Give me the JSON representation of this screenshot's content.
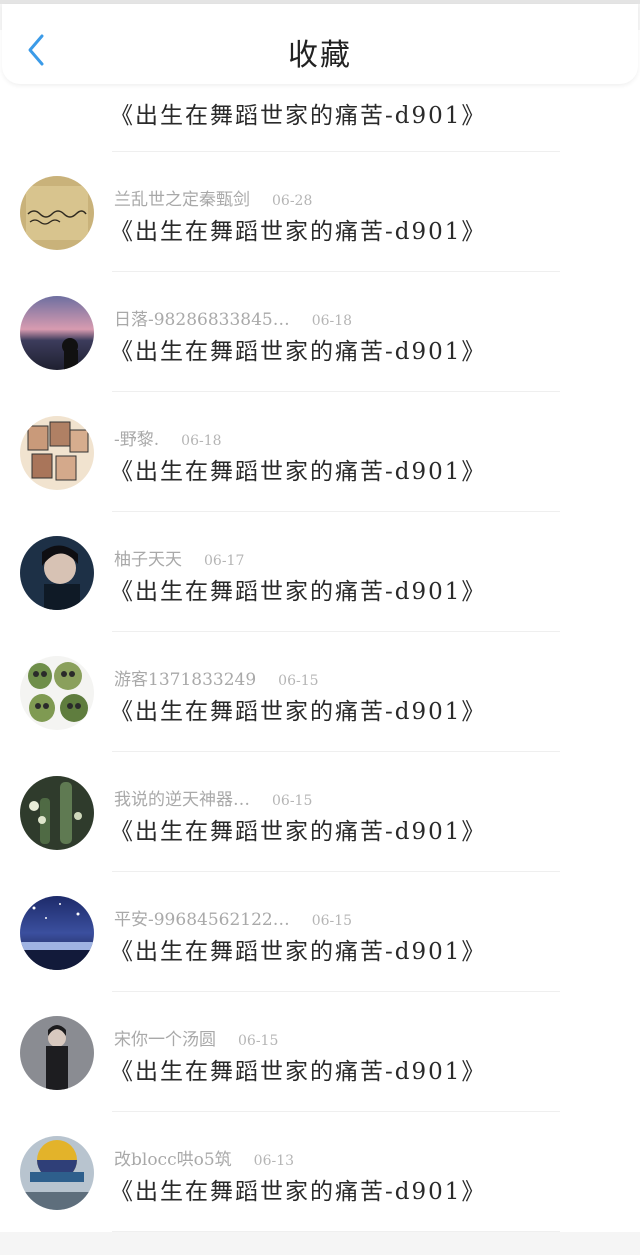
{
  "header": {
    "title": "收藏",
    "back_icon": "chevron-left-icon",
    "accent_color": "#3b9be8"
  },
  "items": [
    {
      "user": "",
      "date": "",
      "song": "《出生在舞蹈世家的痛苦-d901》",
      "avatar": "avatar-girl-photo"
    },
    {
      "user": "兰乱世之定秦甄剑",
      "date": "06-28",
      "song": "《出生在舞蹈世家的痛苦-d901》",
      "avatar": "avatar-handwriting-paper"
    },
    {
      "user": "日落-98286833845…",
      "date": "06-18",
      "song": "《出生在舞蹈世家的痛苦-d901》",
      "avatar": "avatar-sunset"
    },
    {
      "user": "-野黎.",
      "date": "06-18",
      "song": "《出生在舞蹈世家的痛苦-d901》",
      "avatar": "avatar-photo-collage"
    },
    {
      "user": "柚子天天",
      "date": "06-17",
      "song": "《出生在舞蹈世家的痛苦-d901》",
      "avatar": "avatar-portrait-dark"
    },
    {
      "user": "游客1371833249",
      "date": "06-15",
      "song": "《出生在舞蹈世家的痛苦-d901》",
      "avatar": "avatar-skulls"
    },
    {
      "user": "我说的逆天神器…",
      "date": "06-15",
      "song": "《出生在舞蹈世家的痛苦-d901》",
      "avatar": "avatar-plants"
    },
    {
      "user": "平安-99684562122…",
      "date": "06-15",
      "song": "《出生在舞蹈世家的痛苦-d901》",
      "avatar": "avatar-night-sky"
    },
    {
      "user": "宋你一个汤圆",
      "date": "06-15",
      "song": "《出生在舞蹈世家的痛苦-d901》",
      "avatar": "avatar-person-standing"
    },
    {
      "user": "改blocc哄o5筑",
      "date": "06-13",
      "song": "《出生在舞蹈世家的痛苦-d901》",
      "avatar": "avatar-hot-air-balloon"
    }
  ]
}
